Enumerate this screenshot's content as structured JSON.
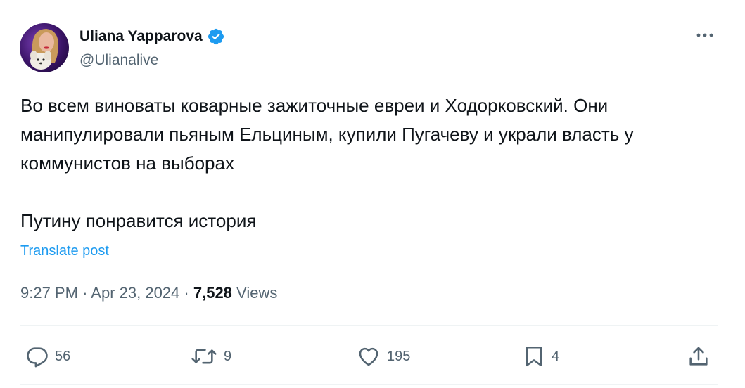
{
  "author": {
    "display_name": "Uliana Yapparova",
    "handle": "@Ulianalive",
    "verified": true
  },
  "post": {
    "text": "Во всем виноваты коварные зажиточные евреи и Ходорковский. Они манипулировали пьяным Ельциным, купили Пугачеву и украли власть у коммунистов на выборах\n\nПутину понравится история",
    "translate_label": "Translate post",
    "time": "9:27 PM",
    "separator": "·",
    "date": "Apr 23, 2024",
    "views_count": "7,528",
    "views_label": "Views"
  },
  "actions": {
    "reply_count": "56",
    "repost_count": "9",
    "like_count": "195",
    "bookmark_count": "4"
  },
  "icons": {
    "verified": "verified-badge-icon",
    "more": "more-horizontal-icon",
    "reply": "reply-icon",
    "repost": "repost-icon",
    "like": "heart-icon",
    "bookmark": "bookmark-icon",
    "share": "share-icon"
  },
  "colors": {
    "accent": "#1d9bf0",
    "text": "#0f1419",
    "secondary": "#536471",
    "divider": "#eff3f4"
  }
}
